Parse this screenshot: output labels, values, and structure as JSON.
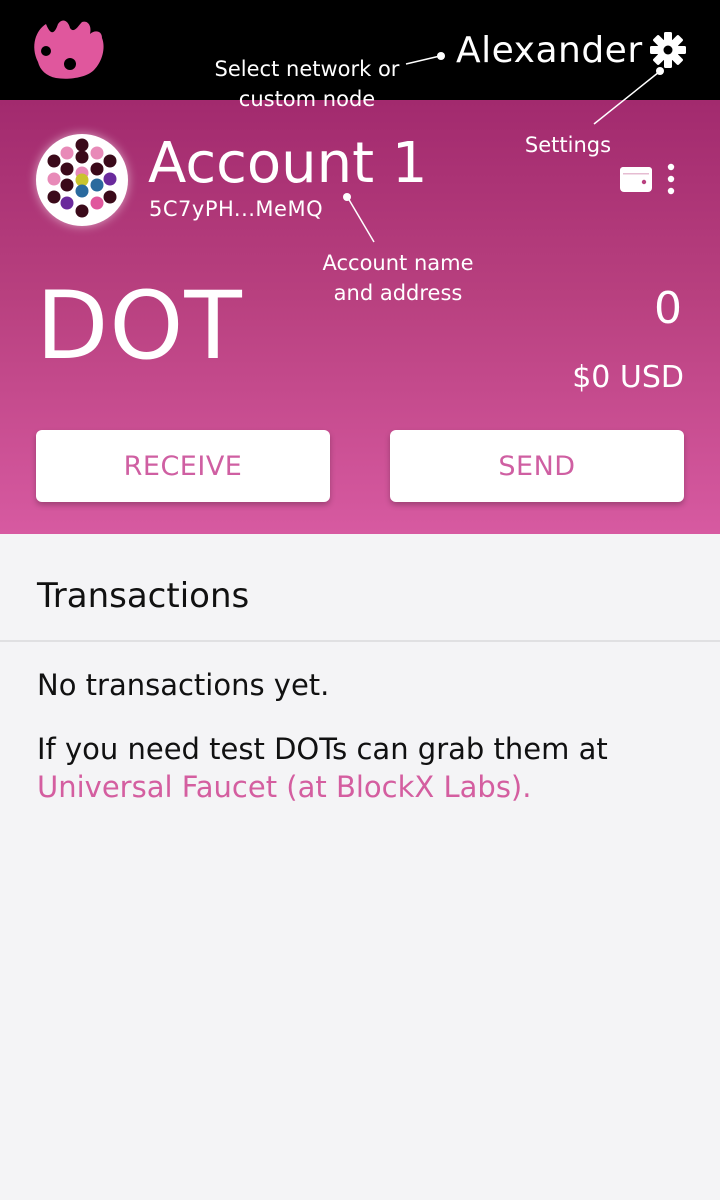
{
  "network": {
    "name": "Alexander"
  },
  "account": {
    "name": "Account 1",
    "address": "5C7yPH...MeMQ"
  },
  "balance": {
    "symbol": "DOT",
    "amount": "0",
    "fiat": "$0 USD"
  },
  "actions": {
    "receive_label": "RECEIVE",
    "send_label": "SEND"
  },
  "annotations": {
    "network_line1": "Select network or",
    "network_line2": "custom node",
    "settings": "Settings",
    "account_line1": "Account name",
    "account_line2": "and address"
  },
  "transactions": {
    "title": "Transactions",
    "empty": "No transactions yet.",
    "faucet_intro": "If you need test DOTs can grab them at",
    "faucet_link": "Universal Faucet (at BlockX Labs)."
  },
  "icons": {
    "logo": "polkadot-logo-icon",
    "settings": "gear-icon",
    "wallet": "wallet-icon",
    "more": "more-vertical-icon"
  },
  "colors": {
    "topbar": "#000000",
    "header_top": "#a22a6e",
    "header_bottom": "#d75aa1",
    "accent": "#cf5fa2",
    "background": "#f4f4f6"
  }
}
